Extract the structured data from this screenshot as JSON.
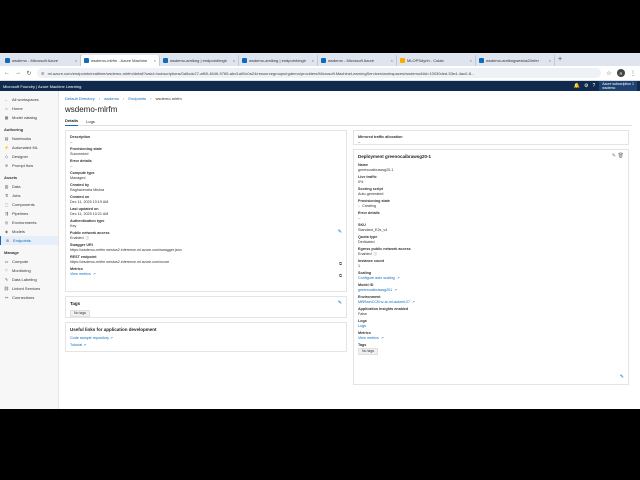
{
  "browser": {
    "tabs": [
      {
        "label": "wsdemo - Microsoft Azure",
        "color": "#0f6cbd",
        "active": false
      },
      {
        "label": "wsdemo-mlrfm - Azure Machine",
        "color": "#0f6cbd",
        "active": true
      },
      {
        "label": "wsdemo-arnlkng | endpoint/mgb",
        "color": "#0f6cbd",
        "active": false
      },
      {
        "label": "wsdemo-arnlkng | endpoint/mgb",
        "color": "#0f6cbd",
        "active": false
      },
      {
        "label": "wsdemo - Microsoft Azure",
        "color": "#0f6cbd",
        "active": false
      },
      {
        "label": "MLOPSdynh - Colab",
        "color": "#f9ab00",
        "active": false
      },
      {
        "label": "wsdemo-arnlkngwestus2/infer",
        "color": "#0f6cbd",
        "active": false
      }
    ],
    "url": "ml.azure.com/endpoints/realtime/wsdemo-mlrfm/detail?wsid=/subscriptions/0a5cdc27-af69-4646-9765-abd1a00c0a24/resourcegroups/rgdemo/providers/Microsoft.MachineLearningServices/workspaces/wsdemo&tid=10030ded-53e4-4ac0-8...",
    "profile_initial": "R"
  },
  "header": {
    "brand": "Microsoft Foundry | Azure Machine Learning",
    "subscription": "Azure subscription 1",
    "workspace": "wsdemo"
  },
  "nav": {
    "back": "All workspaces",
    "top": [
      {
        "label": "Home",
        "icon": "home-icon",
        "glyph": "⌂"
      },
      {
        "label": "Model catalog",
        "icon": "catalog-icon",
        "glyph": "▦"
      }
    ],
    "sections": [
      {
        "title": "Authoring",
        "items": [
          {
            "label": "Notebooks",
            "icon": "notebook-icon",
            "glyph": "▤"
          },
          {
            "label": "Automated ML",
            "icon": "automl-icon",
            "glyph": "⚡"
          },
          {
            "label": "Designer",
            "icon": "designer-icon",
            "glyph": "◇"
          },
          {
            "label": "Prompt flow",
            "icon": "flow-icon",
            "glyph": "≋"
          }
        ]
      },
      {
        "title": "Assets",
        "items": [
          {
            "label": "Data",
            "icon": "data-icon",
            "glyph": "▥"
          },
          {
            "label": "Jobs",
            "icon": "jobs-icon",
            "glyph": "⚗"
          },
          {
            "label": "Components",
            "icon": "components-icon",
            "glyph": "⬚"
          },
          {
            "label": "Pipelines",
            "icon": "pipelines-icon",
            "glyph": "⇶"
          },
          {
            "label": "Environments",
            "icon": "environment-icon",
            "glyph": "◎"
          },
          {
            "label": "Models",
            "icon": "models-icon",
            "glyph": "◈"
          },
          {
            "label": "Endpoints",
            "icon": "endpoints-icon",
            "glyph": "⊛",
            "active": true
          }
        ]
      },
      {
        "title": "Manage",
        "items": [
          {
            "label": "Compute",
            "icon": "compute-icon",
            "glyph": "▭"
          },
          {
            "label": "Monitoring",
            "icon": "monitoring-icon",
            "glyph": "♡"
          },
          {
            "label": "Data Labeling",
            "icon": "labeling-icon",
            "glyph": "✎"
          },
          {
            "label": "Linked Services",
            "icon": "linked-icon",
            "glyph": "⛓"
          },
          {
            "label": "Connections",
            "icon": "connections-icon",
            "glyph": "⚯"
          }
        ]
      }
    ]
  },
  "breadcrumb": [
    "Default Directory",
    "wsdemo",
    "Endpoints",
    "wsdemo-mlrfm"
  ],
  "page": {
    "title": "wsdemo-mlrfm",
    "tabs": [
      "Details",
      "Logs"
    ]
  },
  "details": [
    {
      "label": "Description",
      "value": "--"
    },
    {
      "label": "Provisioning state",
      "value": "Succeeded"
    },
    {
      "label": "Error details",
      "value": "--"
    },
    {
      "label": "Compute type",
      "value": "Managed"
    },
    {
      "label": "Created by",
      "value": "Raghavendra Mishra"
    },
    {
      "label": "Created on",
      "value": "Dec 11, 2025 10:19 AM"
    },
    {
      "label": "Last updated on",
      "value": "Dec 11, 2025 10:21 AM"
    },
    {
      "label": "Authentication type",
      "value": "Key"
    },
    {
      "label": "Public network access",
      "value": "Enabled"
    },
    {
      "label": "Swagger URI",
      "value": "https://wsdemo-mlrfm.westus2.inference.ml.azure.com/swagger.json"
    },
    {
      "label": "REST endpoint",
      "value": "https://wsdemo-mlrfm.westus2.inference.ml.azure.com/score"
    },
    {
      "label": "Metrics",
      "value": "View metrics"
    }
  ],
  "tags_card": {
    "title": "Tags",
    "chip": "No tags"
  },
  "links_card": {
    "title": "Useful links for application development",
    "links": [
      "Code sample repository",
      "Tutorial"
    ]
  },
  "traffic": {
    "label": "Mirrored traffic allocation",
    "value": "--"
  },
  "deployment": {
    "title": "Deployment greenocaibrawsg20-1",
    "fields": [
      {
        "label": "Name",
        "value": "greenocaibrawsg20-1",
        "link": false
      },
      {
        "label": "Live traffic",
        "value": "0%",
        "link": false
      },
      {
        "label": "Scoring script",
        "value": "Auto-generated",
        "link": false
      },
      {
        "label": "Provisioning state",
        "value": "Creating",
        "link": false
      },
      {
        "label": "Error details",
        "value": "--",
        "link": false
      },
      {
        "label": "SKU",
        "value": "Standard_E2s_v4",
        "link": false
      },
      {
        "label": "Quota type",
        "value": "Dedicated",
        "link": false
      },
      {
        "label": "Egress public network access",
        "value": "Enabled",
        "link": false
      },
      {
        "label": "Instance count",
        "value": "1",
        "link": false
      },
      {
        "label": "Scaling",
        "value": "Configure auto scaling",
        "link": true
      },
      {
        "label": "Model ID",
        "value": "greenocaibrawsg201",
        "link": true
      },
      {
        "label": "Environment",
        "value": "MBRwlnCCEnv-ai-ml-automl:27",
        "link": true
      },
      {
        "label": "Application Insights enabled",
        "value": "False",
        "link": false
      },
      {
        "label": "Logs",
        "value": "Logs",
        "link": true
      },
      {
        "label": "Metrics",
        "value": "View metrics",
        "link": true
      }
    ],
    "tags_label": "Tags",
    "tags_chip": "No tags"
  }
}
